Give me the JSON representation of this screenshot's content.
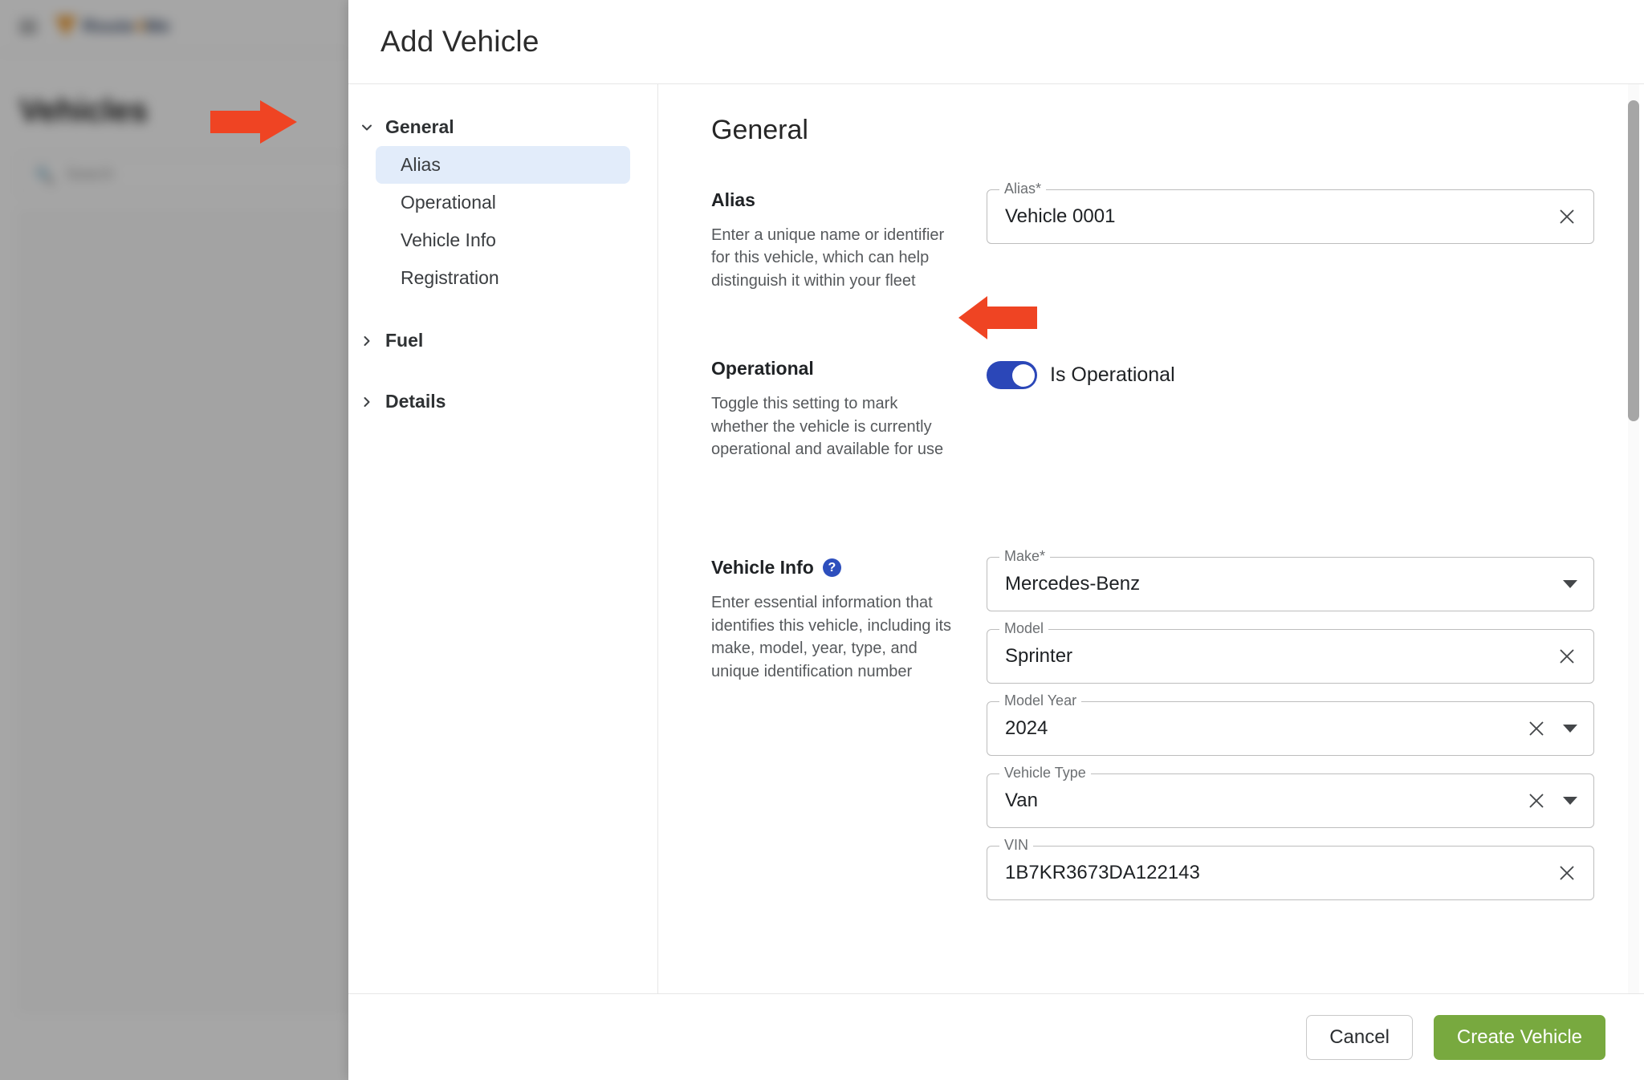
{
  "background": {
    "logo_text_part1": "Route",
    "logo_text_accent": "4",
    "logo_text_part2": "Me",
    "page_heading": "Vehicles",
    "search_placeholder": "Search",
    "search_icon": "search-icon",
    "menu_icon": "hamburger-menu-icon"
  },
  "modal": {
    "title": "Add Vehicle",
    "nav": {
      "groups": [
        {
          "label": "General",
          "expanded": true,
          "chevron": "chevron-down-icon",
          "items": [
            {
              "label": "Alias",
              "active": true
            },
            {
              "label": "Operational",
              "active": false
            },
            {
              "label": "Vehicle Info",
              "active": false
            },
            {
              "label": "Registration",
              "active": false
            }
          ]
        },
        {
          "label": "Fuel",
          "expanded": false,
          "chevron": "chevron-right-icon",
          "items": []
        },
        {
          "label": "Details",
          "expanded": false,
          "chevron": "chevron-right-icon",
          "items": []
        }
      ]
    },
    "content": {
      "title": "General",
      "sections": [
        {
          "heading": "Alias",
          "has_help": false,
          "description": "Enter a unique name or identifier for this vehicle, which can help distinguish it within your fleet",
          "fields": [
            {
              "label": "Alias*",
              "value": "Vehicle 0001",
              "has_clear": true,
              "has_dropdown": false
            }
          ]
        },
        {
          "heading": "Operational",
          "has_help": false,
          "description": "Toggle this setting to mark whether the vehicle is currently operational and available for use",
          "toggle": {
            "label": "Is Operational",
            "on": true,
            "on_color": "#2b47b8"
          }
        },
        {
          "heading": "Vehicle Info",
          "has_help": true,
          "help_glyph": "?",
          "description": "Enter essential information that identifies this vehicle, including its make, model, year, type, and unique identification number",
          "fields": [
            {
              "label": "Make*",
              "value": "Mercedes-Benz",
              "has_clear": false,
              "has_dropdown": true
            },
            {
              "label": "Model",
              "value": "Sprinter",
              "has_clear": true,
              "has_dropdown": false
            },
            {
              "label": "Model Year",
              "value": "2024",
              "has_clear": true,
              "has_dropdown": true
            },
            {
              "label": "Vehicle Type",
              "value": "Van",
              "has_clear": true,
              "has_dropdown": true
            },
            {
              "label": "VIN",
              "value": "1B7KR3673DA122143",
              "has_clear": true,
              "has_dropdown": false
            }
          ]
        }
      ]
    },
    "footer": {
      "cancel_label": "Cancel",
      "create_label": "Create Vehicle",
      "create_color": "#78a93f"
    }
  },
  "annotations": {
    "color": "#ef4423",
    "arrows": [
      {
        "name": "arrow-pointing-to-general-nav",
        "direction": "right"
      },
      {
        "name": "arrow-pointing-to-is-operational-toggle",
        "direction": "left"
      }
    ]
  }
}
